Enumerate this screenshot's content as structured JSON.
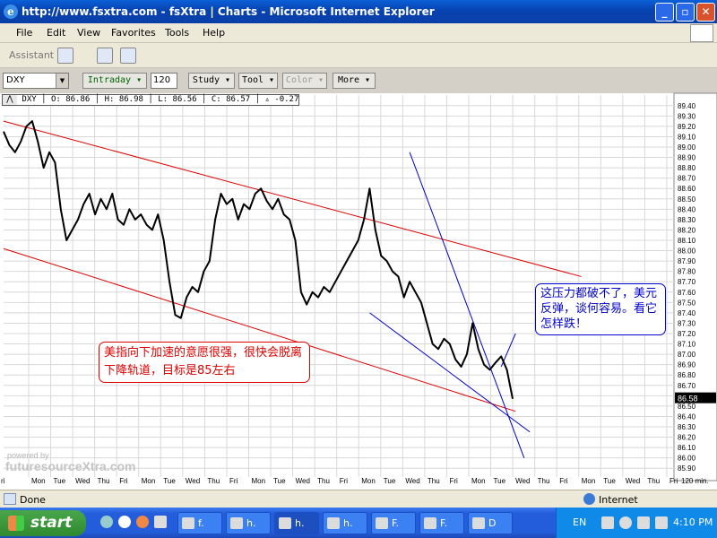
{
  "window": {
    "title": "http://www.fsxtra.com - fsXtra | Charts - Microsoft Internet Explorer"
  },
  "menu": [
    "File",
    "Edit",
    "View",
    "Favorites",
    "Tools",
    "Help"
  ],
  "toolbar": {
    "assistant": "Assistant"
  },
  "controls": {
    "symbol": "DXY",
    "buttons": [
      {
        "label": "Intraday ▾",
        "enabled": true
      },
      {
        "label": "Study ▾",
        "enabled": true
      },
      {
        "label": "Tool ▾",
        "enabled": true
      },
      {
        "label": "Color ▾",
        "enabled": false
      },
      {
        "label": "More ▾",
        "enabled": true
      }
    ],
    "interval": "120"
  },
  "info": {
    "symbol": "DXY",
    "open": "O: 86.86",
    "high": "H: 86.98",
    "low": "L: 86.56",
    "close": "C: 86.57",
    "change": "▵ -0.27"
  },
  "watermark": {
    "line1": "powered by",
    "line2": "futuresourceXtra.com"
  },
  "status": {
    "left": "Done",
    "zone": "Internet"
  },
  "taskbar": {
    "start": "start",
    "tasks": [
      "f.",
      "h.",
      "h.",
      "h.",
      "F.",
      "F.",
      "D"
    ],
    "lang": "EN",
    "clock": "4:10 PM"
  },
  "chart_data": {
    "type": "line",
    "price_axis": {
      "labels": [
        "89.40",
        "89.30",
        "89.20",
        "89.10",
        "89.00",
        "88.90",
        "88.80",
        "88.70",
        "88.60",
        "88.50",
        "88.40",
        "88.30",
        "88.20",
        "88.10",
        "88.00",
        "87.90",
        "87.80",
        "87.70",
        "87.60",
        "87.50",
        "87.40",
        "87.30",
        "87.20",
        "87.10",
        "87.00",
        "86.90",
        "86.80",
        "86.70",
        "86.60",
        "86.50",
        "86.40",
        "86.30",
        "86.20",
        "86.10",
        "86.00",
        "85.90"
      ],
      "ylim": [
        85.85,
        89.45
      ]
    },
    "last_price": "86.58",
    "x_axis": {
      "first_label": "ri",
      "labels": [
        "Mon",
        "Tue",
        "Wed",
        "Thu",
        "Fri",
        "Mon",
        "Tue",
        "Wed",
        "Thu",
        "Fri",
        "Mon",
        "Tue",
        "Wed",
        "Thu",
        "Fri",
        "Mon",
        "Tue",
        "Wed",
        "Thu",
        "Fri",
        "Mon",
        "Tue",
        "Wed",
        "Thu",
        "Fri",
        "Mon",
        "Tue",
        "Wed",
        "Thu",
        "Fri"
      ],
      "unit_label": "120 min."
    },
    "price_series": [
      [
        0,
        89.15
      ],
      [
        1,
        89.02
      ],
      [
        2,
        88.95
      ],
      [
        3,
        89.05
      ],
      [
        4,
        89.2
      ],
      [
        5,
        89.25
      ],
      [
        6,
        89.05
      ],
      [
        7,
        88.8
      ],
      [
        8,
        88.95
      ],
      [
        9,
        88.85
      ],
      [
        10,
        88.4
      ],
      [
        11,
        88.1
      ],
      [
        12,
        88.2
      ],
      [
        13,
        88.3
      ],
      [
        14,
        88.45
      ],
      [
        15,
        88.55
      ],
      [
        16,
        88.35
      ],
      [
        17,
        88.5
      ],
      [
        18,
        88.4
      ],
      [
        19,
        88.55
      ],
      [
        20,
        88.3
      ],
      [
        21,
        88.25
      ],
      [
        22,
        88.4
      ],
      [
        23,
        88.3
      ],
      [
        24,
        88.35
      ],
      [
        25,
        88.25
      ],
      [
        26,
        88.2
      ],
      [
        27,
        88.35
      ],
      [
        28,
        88.1
      ],
      [
        29,
        87.7
      ],
      [
        30,
        87.38
      ],
      [
        31,
        87.35
      ],
      [
        32,
        87.55
      ],
      [
        33,
        87.65
      ],
      [
        34,
        87.6
      ],
      [
        35,
        87.8
      ],
      [
        36,
        87.9
      ],
      [
        37,
        88.3
      ],
      [
        38,
        88.55
      ],
      [
        39,
        88.45
      ],
      [
        40,
        88.5
      ],
      [
        41,
        88.3
      ],
      [
        42,
        88.45
      ],
      [
        43,
        88.4
      ],
      [
        44,
        88.55
      ],
      [
        45,
        88.6
      ],
      [
        46,
        88.48
      ],
      [
        47,
        88.4
      ],
      [
        48,
        88.5
      ],
      [
        49,
        88.35
      ],
      [
        50,
        88.3
      ],
      [
        51,
        88.1
      ],
      [
        52,
        87.6
      ],
      [
        53,
        87.48
      ],
      [
        54,
        87.6
      ],
      [
        55,
        87.55
      ],
      [
        56,
        87.65
      ],
      [
        57,
        87.6
      ],
      [
        58,
        87.7
      ],
      [
        59,
        87.8
      ],
      [
        60,
        87.9
      ],
      [
        61,
        88.0
      ],
      [
        62,
        88.1
      ],
      [
        63,
        88.3
      ],
      [
        64,
        88.6
      ],
      [
        65,
        88.2
      ],
      [
        66,
        87.95
      ],
      [
        67,
        87.9
      ],
      [
        68,
        87.8
      ],
      [
        69,
        87.75
      ],
      [
        70,
        87.55
      ],
      [
        71,
        87.7
      ],
      [
        72,
        87.6
      ],
      [
        73,
        87.5
      ],
      [
        74,
        87.3
      ],
      [
        75,
        87.1
      ],
      [
        76,
        87.05
      ],
      [
        77,
        87.15
      ],
      [
        78,
        87.1
      ],
      [
        79,
        86.95
      ],
      [
        80,
        86.88
      ],
      [
        81,
        87.0
      ],
      [
        82,
        87.3
      ],
      [
        83,
        87.05
      ],
      [
        84,
        86.9
      ],
      [
        85,
        86.85
      ],
      [
        86,
        86.92
      ],
      [
        87,
        86.98
      ],
      [
        88,
        86.85
      ],
      [
        89,
        86.57
      ]
    ],
    "lines": [
      {
        "name": "red channel upper",
        "color": "#dd0000",
        "points": [
          [
            0,
            89.25
          ],
          [
            101,
            87.75
          ]
        ]
      },
      {
        "name": "red channel lower",
        "color": "#dd0000",
        "points": [
          [
            0,
            88.02
          ],
          [
            89.5,
            86.45
          ]
        ]
      },
      {
        "name": "blue steep",
        "color": "#0000cc",
        "points": [
          [
            71,
            88.95
          ],
          [
            91,
            86.0
          ]
        ]
      },
      {
        "name": "blue support",
        "color": "#0000cc",
        "points": [
          [
            64,
            87.4
          ],
          [
            92,
            86.25
          ]
        ]
      },
      {
        "name": "blue callout",
        "color": "#0000cc",
        "points": [
          [
            87,
            86.88
          ],
          [
            89.5,
            87.2
          ]
        ]
      }
    ],
    "annotations": [
      {
        "name": "left-note",
        "text": "美指向下加速的意愿很强，很快会脱离下降轨道，目标是85左右",
        "color": "#dd0000"
      },
      {
        "name": "right-note",
        "text": "这压力都破不了，美元反弹，谈何容易。看它怎样跌！",
        "color": "#0000cc"
      }
    ]
  }
}
